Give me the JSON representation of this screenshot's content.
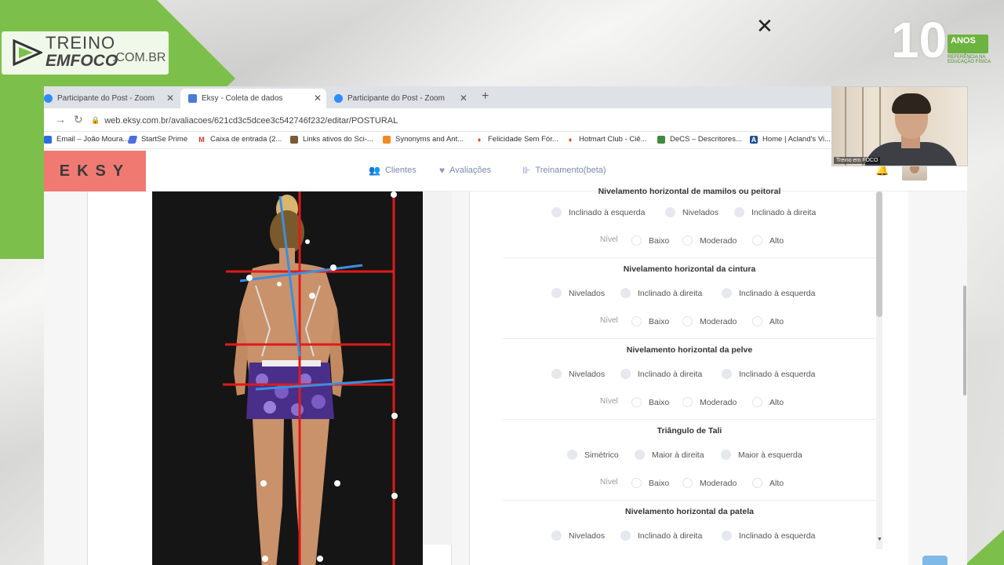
{
  "overlay": {
    "logo_line1": "TREINO",
    "logo_line2": "EMFOCO",
    "logo_domain": ".COM.BR",
    "anniv_number": "10",
    "anniv_badge": "ANOS",
    "anniv_sub": "REFERÊNCIA NA EDUCAÇÃO FÍSICA"
  },
  "browser": {
    "tabs": [
      {
        "label": "Participante do Post - Zoom",
        "active": false
      },
      {
        "label": "Eksy - Coleta de dados",
        "active": true
      },
      {
        "label": "Participante do Post - Zoom",
        "active": false
      }
    ],
    "url": "web.eksy.com.br/avaliacoes/621cd3c5dcee3c542746f232/editar/POSTURAL",
    "bookmarks": [
      {
        "label": "Email – João Moura...",
        "icon": "mail-icon"
      },
      {
        "label": "StartSe Prime",
        "icon": "startse-icon"
      },
      {
        "label": "Caixa de entrada (2...",
        "icon": "gmail-icon"
      },
      {
        "label": "Links ativos do Sci-...",
        "icon": "scihub-icon"
      },
      {
        "label": "Synonyms and Ant...",
        "icon": "thesaurus-icon"
      },
      {
        "label": "Felicidade Sem Fór...",
        "icon": "hotmart-icon"
      },
      {
        "label": "Hotmart Club - Ciê...",
        "icon": "hotmart-icon"
      },
      {
        "label": "DeCS – Descritores...",
        "icon": "decs-icon"
      },
      {
        "label": "Home | Acland's Vi...",
        "icon": "acland-icon"
      }
    ]
  },
  "site": {
    "brand": "EKSY",
    "nav": [
      "Clientes",
      "Avaliações",
      "Treinamento(beta)"
    ]
  },
  "form": {
    "sections": [
      {
        "title": "Nivelamento horizontal de mamilos ou peitoral",
        "options": [
          "Inclinado à esquerda",
          "Nivelados",
          "Inclinado à direita"
        ],
        "level_label": "Nível",
        "levels": [
          "Baixo",
          "Moderado",
          "Alto"
        ]
      },
      {
        "title": "Nivelamento horizontal da cintura",
        "options": [
          "Nivelados",
          "Inclinado à direita",
          "Inclinado à esquerda"
        ],
        "level_label": "Nível",
        "levels": [
          "Baixo",
          "Moderado",
          "Alto"
        ]
      },
      {
        "title": "Nivelamento horizontal da pelve",
        "options": [
          "Nivelados",
          "Inclinado à direita",
          "Inclinado à esquerda"
        ],
        "level_label": "Nível",
        "levels": [
          "Baixo",
          "Moderado",
          "Alto"
        ]
      },
      {
        "title": "Triângulo de Tali",
        "options": [
          "Simétrico",
          "Maior à direita",
          "Maior à esquerda"
        ],
        "level_label": "Nível",
        "levels": [
          "Baixo",
          "Moderado",
          "Alto"
        ]
      },
      {
        "title": "Nivelamento horizontal da patela",
        "options": [
          "Nivelados",
          "Inclinado à direita",
          "Inclinado à esquerda"
        ]
      }
    ]
  },
  "zoom": {
    "participant_label": "Treino em FOCO"
  },
  "colors": {
    "brand_green": "#7cc04b",
    "eksy_coral": "#f07a72",
    "nav_blue": "#7a8ab0",
    "posture_red": "#e01a1a",
    "posture_blue": "#3a8fe0"
  }
}
